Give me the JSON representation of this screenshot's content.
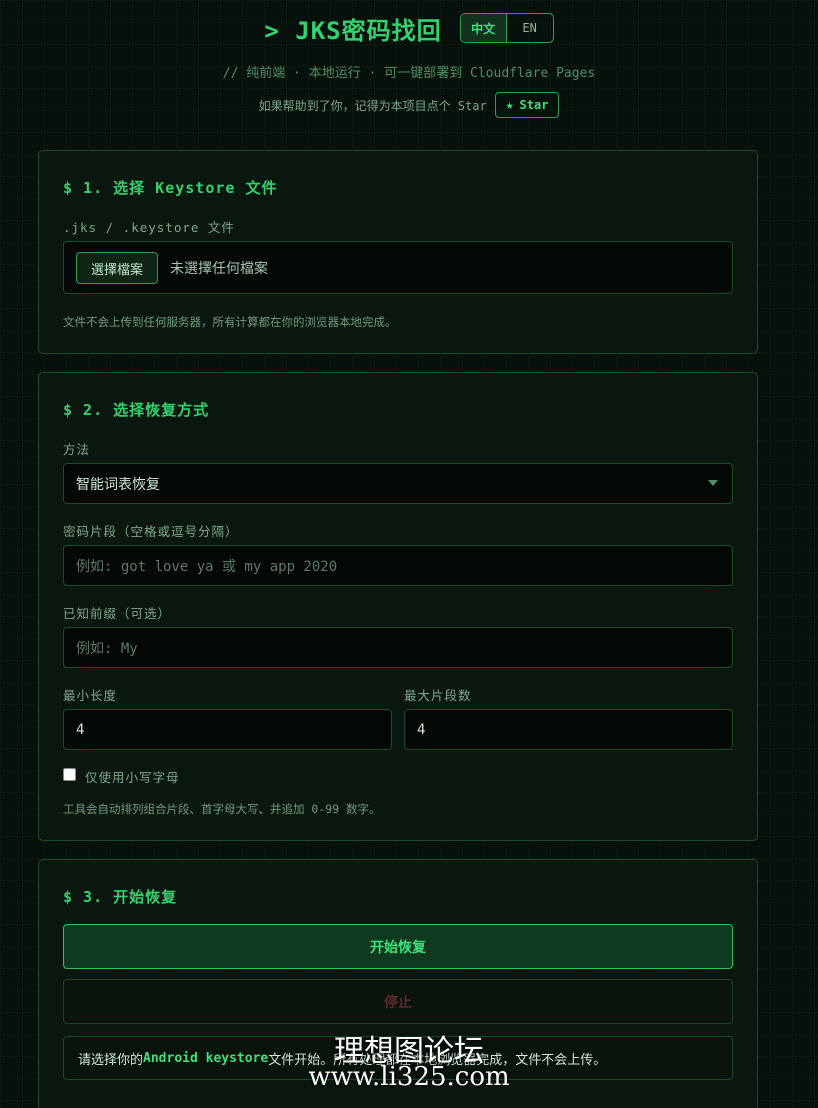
{
  "header": {
    "title": "> JKS密码找回",
    "lang": {
      "zh": "中文",
      "en": "EN"
    },
    "subtitle": "// 纯前端 · 本地运行 · 可一键部署到 Cloudflare Pages",
    "star_prompt": "如果帮助到了你，记得为本项目点个 Star",
    "star_button": "Star"
  },
  "section1": {
    "title": "$ 1. 选择 Keystore 文件",
    "file_label": ".jks / .keystore 文件",
    "choose_button": "選擇檔案",
    "file_status": "未選擇任何檔案",
    "note": "文件不会上传到任何服务器，所有计算都在你的浏览器本地完成。"
  },
  "section2": {
    "title": "$ 2. 选择恢复方式",
    "method_label": "方法",
    "method_value": "智能词表恢复",
    "fragments_label": "密码片段（空格或逗号分隔）",
    "fragments_placeholder": "例如: got love ya 或 my app 2020",
    "prefix_label": "已知前缀（可选）",
    "prefix_placeholder": "例如: My",
    "min_length_label": "最小长度",
    "min_length_value": "4",
    "max_segments_label": "最大片段数",
    "max_segments_value": "4",
    "lowercase_label": "仅使用小写字母",
    "note": "工具会自动排列组合片段、首字母大写、并追加 0-99 数字。"
  },
  "section3": {
    "title": "$ 3. 开始恢复",
    "start_button": "开始恢复",
    "stop_button": "停止",
    "status_prefix": "请选择你的 ",
    "status_highlight": "Android keystore",
    "status_suffix": " 文件开始。所有处理都在本地浏览器完成，文件不会上传。"
  },
  "watermark": {
    "line1": "理想图论坛",
    "line2": "www.li325.com"
  },
  "colors": {
    "background": "#07110b",
    "accent": "#35d170",
    "border": "#1d4a2b"
  }
}
